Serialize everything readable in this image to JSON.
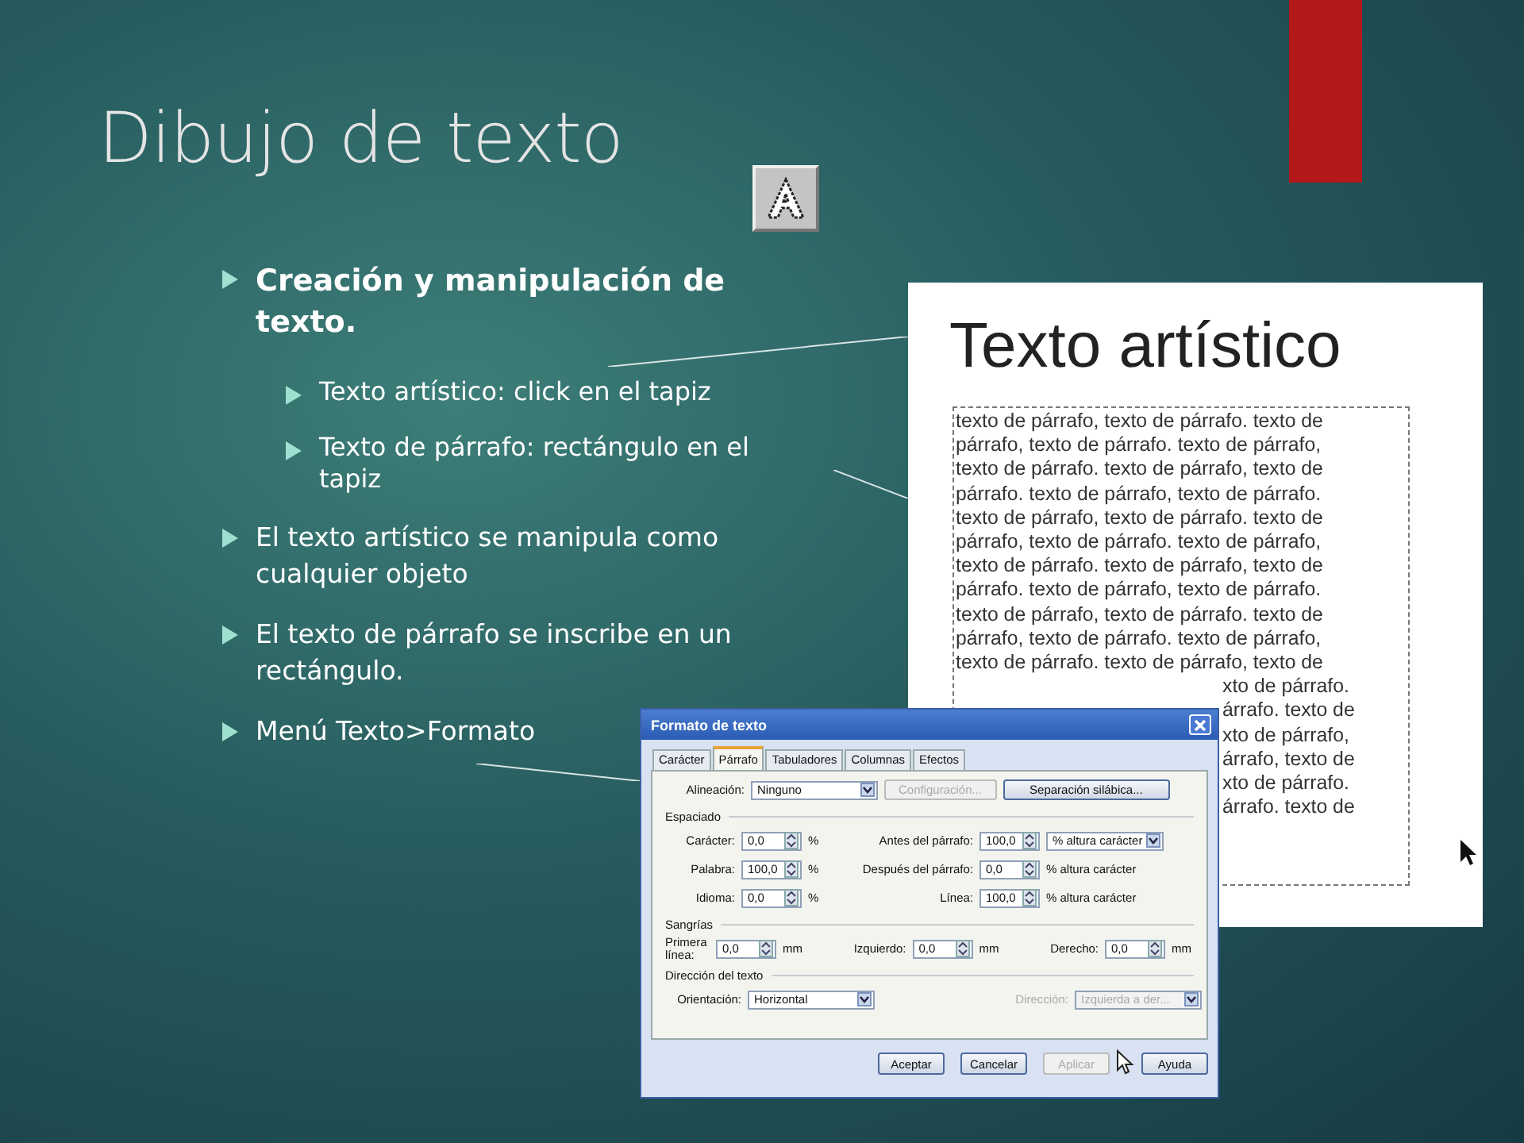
{
  "slide": {
    "title": "Dibujo de texto"
  },
  "bullets": [
    {
      "kind": "heading",
      "text": "Creación y manipulación de texto.",
      "children": [
        {
          "text": "Texto artístico: click en el tapiz"
        },
        {
          "text": "Texto de párrafo: rectángulo en el tapiz"
        }
      ]
    },
    {
      "kind": "normal",
      "text": "El texto artístico se manipula como cualquier objeto"
    },
    {
      "kind": "normal",
      "text": "El texto de párrafo se inscribe en un rectángulo."
    },
    {
      "kind": "normal",
      "text": "Menú Texto>Formato"
    }
  ],
  "artwork": {
    "title": "Texto artístico",
    "paragraph_lines": [
      "texto de párrafo, texto de párrafo. texto de",
      "párrafo, texto de párrafo. texto de párrafo,",
      "texto de párrafo. texto de párrafo, texto de",
      "párrafo. texto de párrafo, texto de párrafo.",
      "texto de párrafo, texto de párrafo. texto de",
      "párrafo, texto de párrafo. texto de párrafo,",
      "texto de párrafo. texto de párrafo, texto de",
      "párrafo. texto de párrafo, texto de párrafo.",
      "texto de párrafo, texto de párrafo. texto de",
      "párrafo, texto de párrafo. texto de párrafo,",
      "texto de párrafo. texto de párrafo, texto de"
    ],
    "visible_fragments": [
      "xto de párrafo.",
      "árrafo. texto de",
      "xto de párrafo,",
      "árrafo, texto de",
      "xto de párrafo.",
      "árrafo. texto de"
    ]
  },
  "dialog": {
    "title": "Formato de texto",
    "tabs": [
      {
        "label": "Carácter",
        "selected": false
      },
      {
        "label": "Párrafo",
        "selected": true
      },
      {
        "label": "Tabuladores",
        "selected": false
      },
      {
        "label": "Columnas",
        "selected": false
      },
      {
        "label": "Efectos",
        "selected": false
      }
    ],
    "top_row": [
      {
        "kind": "label",
        "text": "Alineación:",
        "disabled": false
      },
      {
        "kind": "select",
        "text": "Ninguno",
        "disabled": false
      },
      {
        "kind": "button",
        "text": "Configuración...",
        "disabled": true
      },
      {
        "kind": "button",
        "text": "Separación silábica...",
        "disabled": false
      }
    ],
    "sections": [
      {
        "title": "Espaciado",
        "fields": [
          {
            "kind": "spin",
            "label": "Carácter:",
            "value": "0,0",
            "unit": "%",
            "unit_dropdown": false,
            "disabled": false
          },
          {
            "kind": "spin",
            "label": "Antes del párrafo:",
            "value": "100,0",
            "unit": "% altura carácter",
            "unit_dropdown": true,
            "disabled": false
          },
          {
            "kind": "spin",
            "label": "Palabra:",
            "value": "100,0",
            "unit": "%",
            "unit_dropdown": false,
            "disabled": false
          },
          {
            "kind": "spin",
            "label": "Después del párrafo:",
            "value": "0,0",
            "unit": "% altura carácter",
            "unit_dropdown": false,
            "disabled": false
          },
          {
            "kind": "spin",
            "label": "Idioma:",
            "value": "0,0",
            "unit": "%",
            "unit_dropdown": false,
            "disabled": false
          },
          {
            "kind": "spin",
            "label": "Línea:",
            "value": "100,0",
            "unit": "% altura carácter",
            "unit_dropdown": false,
            "disabled": false
          }
        ]
      },
      {
        "title": "Sangrías",
        "fields": [
          {
            "kind": "spin",
            "label": "Primera línea:",
            "value": "0,0",
            "unit": "mm",
            "unit_dropdown": false,
            "disabled": false
          },
          {
            "kind": "spin",
            "label": "Izquierdo:",
            "value": "0,0",
            "unit": "mm",
            "unit_dropdown": false,
            "disabled": false
          },
          {
            "kind": "spin",
            "label": "Derecho:",
            "value": "0,0",
            "unit": "mm",
            "unit_dropdown": false,
            "disabled": false
          }
        ]
      },
      {
        "title": "Dirección del texto",
        "fields": [
          {
            "kind": "select",
            "label": "Orientación:",
            "value": "Horizontal",
            "disabled": false
          },
          {
            "kind": "select",
            "label": "Dirección:",
            "value": "Izquierda a der...",
            "disabled": true
          }
        ]
      }
    ],
    "buttons": [
      {
        "text": "Aceptar",
        "disabled": false
      },
      {
        "text": "Cancelar",
        "disabled": false
      },
      {
        "text": "Aplicar",
        "disabled": true
      },
      {
        "text": "Ayuda",
        "disabled": false
      }
    ]
  }
}
